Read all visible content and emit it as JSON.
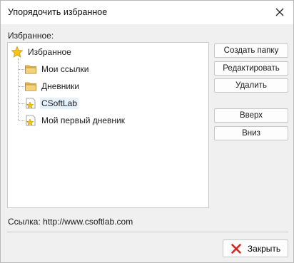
{
  "window": {
    "title": "Упорядочить избранное",
    "close_icon": "close-icon"
  },
  "favorites_label": "Избранное:",
  "tree": {
    "root": {
      "label": "Избранное",
      "icon": "star-icon"
    },
    "items": [
      {
        "label": "Мои ссылки",
        "icon": "folder-icon",
        "selected": false
      },
      {
        "label": "Дневники",
        "icon": "folder-icon",
        "selected": false
      },
      {
        "label": "CSoftLab",
        "icon": "star-page-icon",
        "selected": true
      },
      {
        "label": "Мой первый дневник",
        "icon": "star-page-icon",
        "selected": false
      }
    ]
  },
  "buttons": {
    "create_folder": "Создать папку",
    "edit": "Редактировать",
    "delete": "Удалить",
    "up": "Вверх",
    "down": "Вниз"
  },
  "link": {
    "text": "Ссылка: http://www.csoftlab.com"
  },
  "footer": {
    "close_label": "Закрыть",
    "close_icon": "red-x-icon"
  },
  "colors": {
    "selection": "#e5f1fb",
    "star": "#f5c518",
    "folder": "#e8b84a",
    "close_x": "#d9261c"
  }
}
